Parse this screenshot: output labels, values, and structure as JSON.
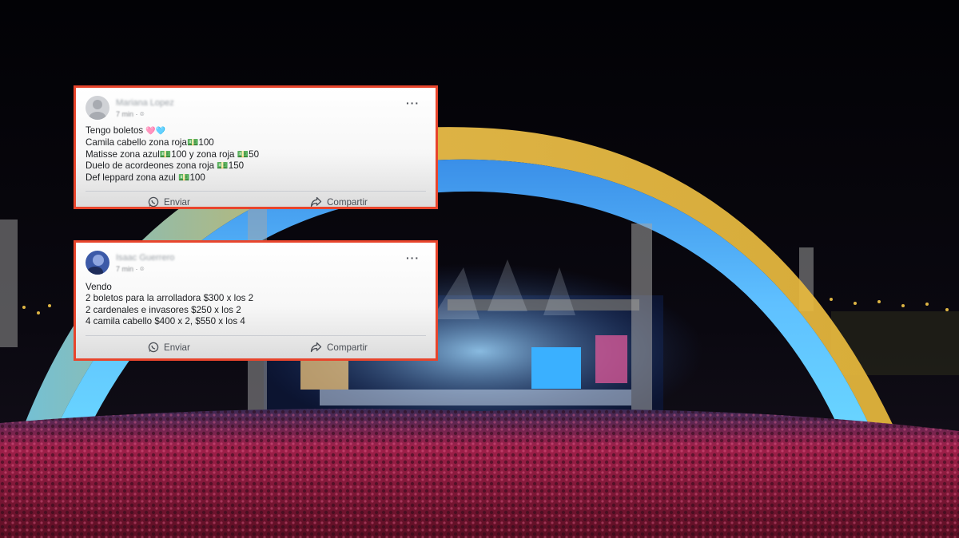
{
  "posts": [
    {
      "author": "Mariana Lopez",
      "time": "7 min",
      "body": [
        {
          "text": "Tengo boletos ",
          "suffix": "🩷🩵"
        },
        {
          "text": "Camila cabello zona roja💵100"
        },
        {
          "text": "Matisse zona azul💵100 y zona roja 💵50"
        },
        {
          "text": "Duelo de acordeones zona roja 💵150"
        },
        {
          "text": "Def leppard zona azul 💵100"
        }
      ],
      "send_label": "Enviar",
      "share_label": "Compartir"
    },
    {
      "author": "Isaac Guerrero",
      "time": "7 min",
      "body": [
        {
          "text": "Vendo"
        },
        {
          "text": "2 boletos para la arrolladora $300 x los 2"
        },
        {
          "text": "2 cardenales e invasores $250 x los 2"
        },
        {
          "text": "4 camila cabello $400 x 2, $550 x los 4"
        }
      ],
      "send_label": "Enviar",
      "share_label": "Compartir"
    }
  ],
  "icons": {
    "more": "more-options-icon",
    "send": "whatsapp-icon",
    "share": "share-arrow-icon",
    "audience": "audience-globe-icon",
    "money": "money-bill-icon"
  },
  "colors": {
    "highlight_border": "#e8452c",
    "arch_blue": "#4fb2ff",
    "arch_gold": "#f2c74a",
    "crowd_pink": "#d4305f",
    "night_sky": "#05040a"
  }
}
